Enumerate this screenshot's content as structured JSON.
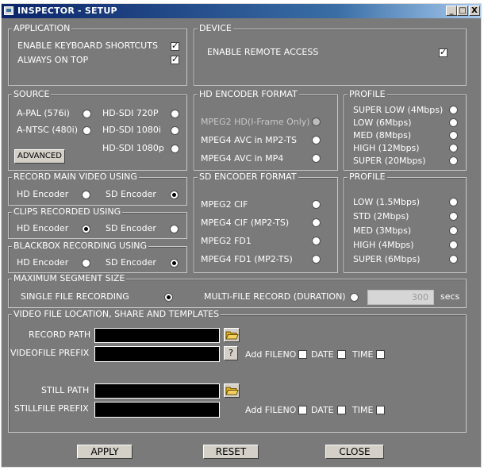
{
  "window": {
    "title": "INSPECTOR - SETUP",
    "minimize": "_",
    "maximize": "□",
    "close": "X"
  },
  "application": {
    "legend": "APPLICATION",
    "enable_shortcuts": "ENABLE KEYBOARD SHORTCUTS",
    "always_on_top": "ALWAYS ON TOP"
  },
  "device": {
    "legend": "DEVICE",
    "remote_access": "ENABLE REMOTE ACCESS"
  },
  "source": {
    "legend": "SOURCE",
    "a_pal": "A-PAL (576i)",
    "a_ntsc": "A-NTSC (480i)",
    "hd_720p": "HD-SDI 720P",
    "hd_1080i": "HD-SDI 1080i",
    "hd_1080p": "HD-SDI 1080p",
    "advanced": "ADVANCED"
  },
  "hd_encoder": {
    "legend": "HD ENCODER FORMAT",
    "mpeg2_hd": "MPEG2 HD(I-Frame Only)",
    "mpeg4_ts": "MPEG4 AVC in MP2-TS",
    "mpeg4_mp4": "MPEG4 AVC in MP4"
  },
  "hd_profile": {
    "legend": "PROFILE",
    "items": [
      "SUPER LOW (4Mbps)",
      "LOW (6Mbps)",
      "MED (8Mbps)",
      "HIGH (12Mbps)",
      "SUPER (20Mbps)"
    ]
  },
  "record_main": {
    "legend": "RECORD MAIN VIDEO USING",
    "hd": "HD Encoder",
    "sd": "SD Encoder"
  },
  "clips": {
    "legend": "CLIPS RECORDED USING",
    "hd": "HD Encoder",
    "sd": "SD Encoder"
  },
  "blackbox": {
    "legend": "BLACKBOX RECORDING USING",
    "hd": "HD Encoder",
    "sd": "SD Encoder"
  },
  "sd_encoder": {
    "legend": "SD ENCODER FORMAT",
    "items": [
      "MPEG2 CIF",
      "MPEG4 CIF (MP2-TS)",
      "MPEG2 FD1",
      "MPEG4 FD1 (MP2-TS)"
    ]
  },
  "sd_profile": {
    "legend": "PROFILE",
    "items": [
      "LOW (1.5Mbps)",
      "STD (2Mbps)",
      "MED (3Mbps)",
      "HIGH (4Mbps)",
      "SUPER (6Mbps)"
    ]
  },
  "segment": {
    "legend": "MAXIMUM SEGMENT SIZE",
    "single": "SINGLE FILE RECORDING",
    "multi": "MULTI-FILE RECORD (DURATION)",
    "duration": "300",
    "unit": "secs"
  },
  "location": {
    "legend": "VIDEO FILE LOCATION, SHARE AND TEMPLATES",
    "record_path": "RECORD PATH",
    "videofile_prefix": "VIDEOFILE PREFIX",
    "help": "?",
    "add_fileno": "Add FILENO",
    "date": "DATE",
    "time": "TIME",
    "still_path": "STILL PATH",
    "stillfile_prefix": "STILLFILE PREFIX"
  },
  "footer": {
    "apply": "APPLY",
    "reset": "RESET",
    "close": "CLOSE"
  }
}
